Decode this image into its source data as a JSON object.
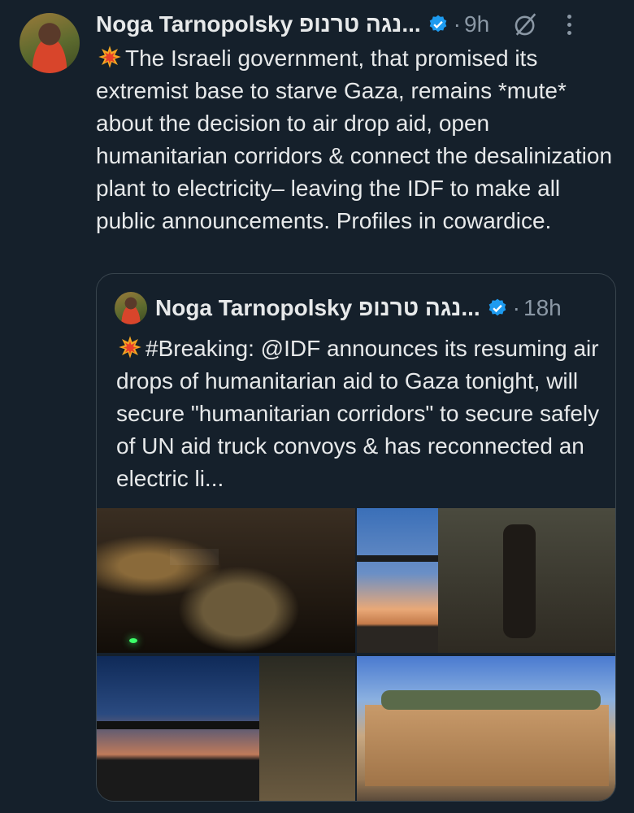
{
  "tweet": {
    "author_name": "Noga Tarnopolsky נגה טרנופ...",
    "time": "9h",
    "body": "The Israeli government, that promised its extremist base to starve Gaza, remains *mute* about the decision to air drop aid, open humanitarian corridors & connect the desalinization plant to electricity– leaving the IDF to make all public announcements. Profiles in cowardice.",
    "emoji": "💥"
  },
  "quoted": {
    "author_name": "Noga Tarnopolsky נגה טרנופ...",
    "time": "18h",
    "body": "#Breaking: @IDF announces its resuming air drops of humanitarian aid to Gaza tonight, will secure \"humanitarian corridors\" to secure safely of UN aid truck convoys & has reconnected an electric li...",
    "emoji": "💥"
  },
  "icons": {
    "verified": "verified-badge-icon",
    "grok": "grok-icon",
    "more": "more-options-icon"
  },
  "colors": {
    "background": "#15202b",
    "text": "#e7e9ea",
    "muted": "#8b98a5",
    "verified": "#1d9bf0",
    "border": "#38444d"
  }
}
